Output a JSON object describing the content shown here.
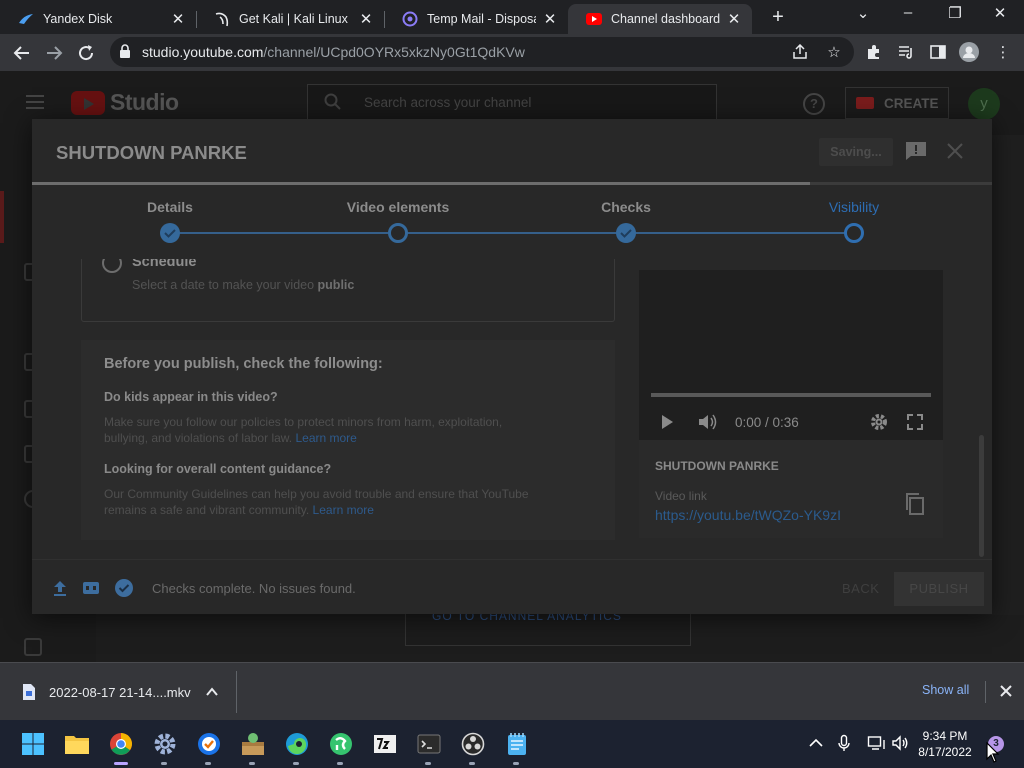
{
  "browser": {
    "tabs": [
      {
        "title": "Yandex Disk",
        "icon": "yandex-disk-icon",
        "active": false
      },
      {
        "title": "Get Kali | Kali Linux",
        "icon": "kali-dragon-icon",
        "active": false
      },
      {
        "title": "Temp Mail - Disposable",
        "icon": "tempmail-icon",
        "active": false
      },
      {
        "title": "Channel dashboard - YouTube Studio",
        "icon": "youtube-icon",
        "active": true
      }
    ],
    "url_host": "studio.youtube.com",
    "url_path": "/channel/UCpd0OYRx5xkzNy0Gt1QdKVw"
  },
  "studio": {
    "logo_text": "Studio",
    "search_placeholder": "Search across your channel",
    "create_label": "CREATE",
    "avatar_initial": "y",
    "background_card_text": "GO TO CHANNEL ANALYTICS"
  },
  "dialog": {
    "title": "SHUTDOWN PANRKE",
    "saving_label": "Saving...",
    "upload_progress": 0.81,
    "steps": [
      {
        "label": "Details",
        "state": "done"
      },
      {
        "label": "Video elements",
        "state": "pending"
      },
      {
        "label": "Checks",
        "state": "done"
      },
      {
        "label": "Visibility",
        "state": "current"
      }
    ],
    "schedule": {
      "title": "Schedule",
      "subtitle_prefix": "Select a date to make your video ",
      "subtitle_bold": "public"
    },
    "checklist": {
      "heading": "Before you publish, check the following:",
      "kids_question": "Do kids appear in this video?",
      "kids_text": "Make sure you follow our policies to protect minors from harm, exploitation, bullying, and violations of labor law.",
      "guidance_question": "Looking for overall content guidance?",
      "guidance_text": "Our Community Guidelines can help you avoid trouble and ensure that YouTube remains a safe and vibrant community.",
      "learn_more": "Learn more"
    },
    "preview": {
      "time": "0:00 / 0:36",
      "title": "SHUTDOWN PANRKE",
      "link_label": "Video link",
      "link": "https://youtu.be/tWQZo-YK9zI"
    },
    "footer": {
      "status": "Checks complete. No issues found.",
      "back_label": "BACK",
      "publish_label": "PUBLISH"
    }
  },
  "downloads": {
    "file_name": "2022-08-17 21-14....mkv",
    "show_all": "Show all"
  },
  "taskbar": {
    "time": "9:34 PM",
    "date": "8/17/2022",
    "notifications": "3"
  },
  "colors": {
    "accent_blue": "#35699b",
    "link_blue": "#2b5b8d",
    "taskbar_bg": "#1c2230",
    "chrome_bg": "#202124"
  }
}
